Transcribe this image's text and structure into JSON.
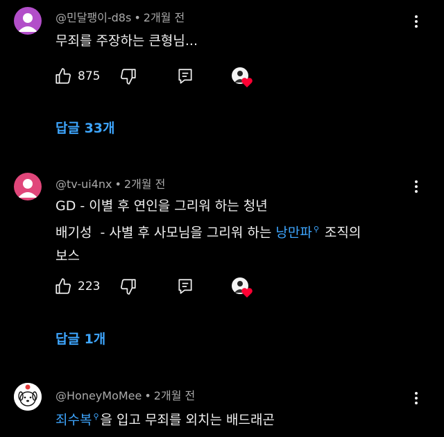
{
  "comments": [
    {
      "author": "@민달팽이-d8s",
      "time": "2개월 전",
      "line1": "무죄를 주장하는 큰형님...",
      "likes": "875",
      "replies": "답글 33개",
      "avatar_color": "#b24ec9"
    },
    {
      "author": "@tv-ui4nx",
      "time": "2개월 전",
      "line1": "GD - 이별 후 연인을 그리워 하는 청년",
      "line2_pre": "배기성  - 사별 후 사모님을 그리워 하는 ",
      "line2_link": "낭만파",
      "line2_post": "조직의",
      "line3": "보스",
      "likes": "223",
      "replies": "답글 1개",
      "avatar_color": "#e0467a"
    },
    {
      "author": "@HoneyMoMee",
      "time": "2개월 전",
      "line1_link": "죄수복",
      "line1_post": "을 입고 무죄를 외치는 배드래곤"
    }
  ],
  "separator": "•",
  "icons": {
    "like": "thumbs-up-icon",
    "dislike": "thumbs-down-icon",
    "reply": "reply-comment-icon",
    "more": "more-vertical-icon",
    "search": "search-icon",
    "heart": "creator-heart-icon"
  },
  "colors": {
    "background": "#000000",
    "link": "#3ea6ff",
    "heart": "#ff0033",
    "meta": "#aaaaaa"
  }
}
